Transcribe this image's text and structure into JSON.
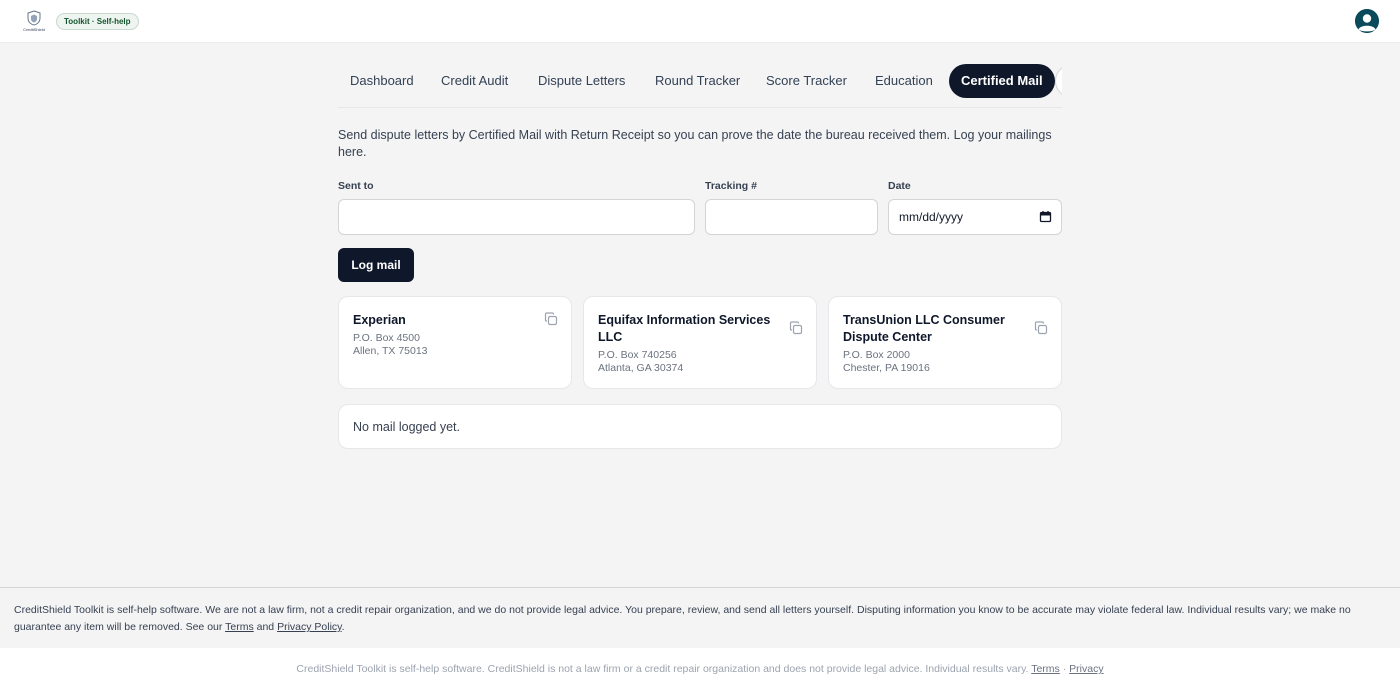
{
  "header": {
    "logo_text": "CreditShield",
    "badge": "Toolkit · Self-help"
  },
  "tabs": [
    {
      "label": "Dashboard",
      "active": false
    },
    {
      "label": "Credit Audit",
      "active": false
    },
    {
      "label": "Dispute Letters",
      "active": false
    },
    {
      "label": "Round Tracker",
      "active": false
    },
    {
      "label": "Score Tracker",
      "active": false
    },
    {
      "label": "Education",
      "active": false
    },
    {
      "label": "Certified Mail",
      "active": true
    }
  ],
  "intro": "Send dispute letters by Certified Mail with Return Receipt so you can prove the date the bureau received them. Log your mailings here.",
  "form": {
    "sent_to_label": "Sent to",
    "sent_to_value": "",
    "tracking_label": "Tracking #",
    "tracking_value": "",
    "date_label": "Date",
    "date_placeholder": "mm/dd/yyyy",
    "submit_label": "Log mail"
  },
  "bureaus": [
    {
      "name": "Experian",
      "line1": "P.O. Box 4500",
      "line2": "Allen, TX 75013"
    },
    {
      "name": "Equifax Information Services LLC",
      "line1": "P.O. Box 740256",
      "line2": "Atlanta, GA 30374"
    },
    {
      "name": "TransUnion LLC Consumer Dispute Center",
      "line1": "P.O. Box 2000",
      "line2": "Chester, PA 19016"
    }
  ],
  "mail_log": {
    "empty_text": "No mail logged yet."
  },
  "disclaimer": {
    "text": "CreditShield Toolkit is self-help software. We are not a law firm, not a credit repair organization, and we do not provide legal advice. You prepare, review, and send all letters yourself. Disputing information you know to be accurate may violate federal law. Individual results vary; we make no guarantee any item will be removed. See our",
    "terms_link": "Terms",
    "and": "and",
    "privacy_link": "Privacy Policy",
    "end": "."
  },
  "footer": {
    "text": "CreditShield Toolkit is self-help software. CreditShield is not a law firm or a credit repair organization and does not provide legal advice. Individual results vary.",
    "terms_link": "Terms",
    "separator": "·",
    "privacy_link": "Privacy"
  },
  "colors": {
    "primary": "#0f172a",
    "background": "#f4f4f5",
    "avatar": "#0b4a5a",
    "badge_text": "#14532d"
  }
}
